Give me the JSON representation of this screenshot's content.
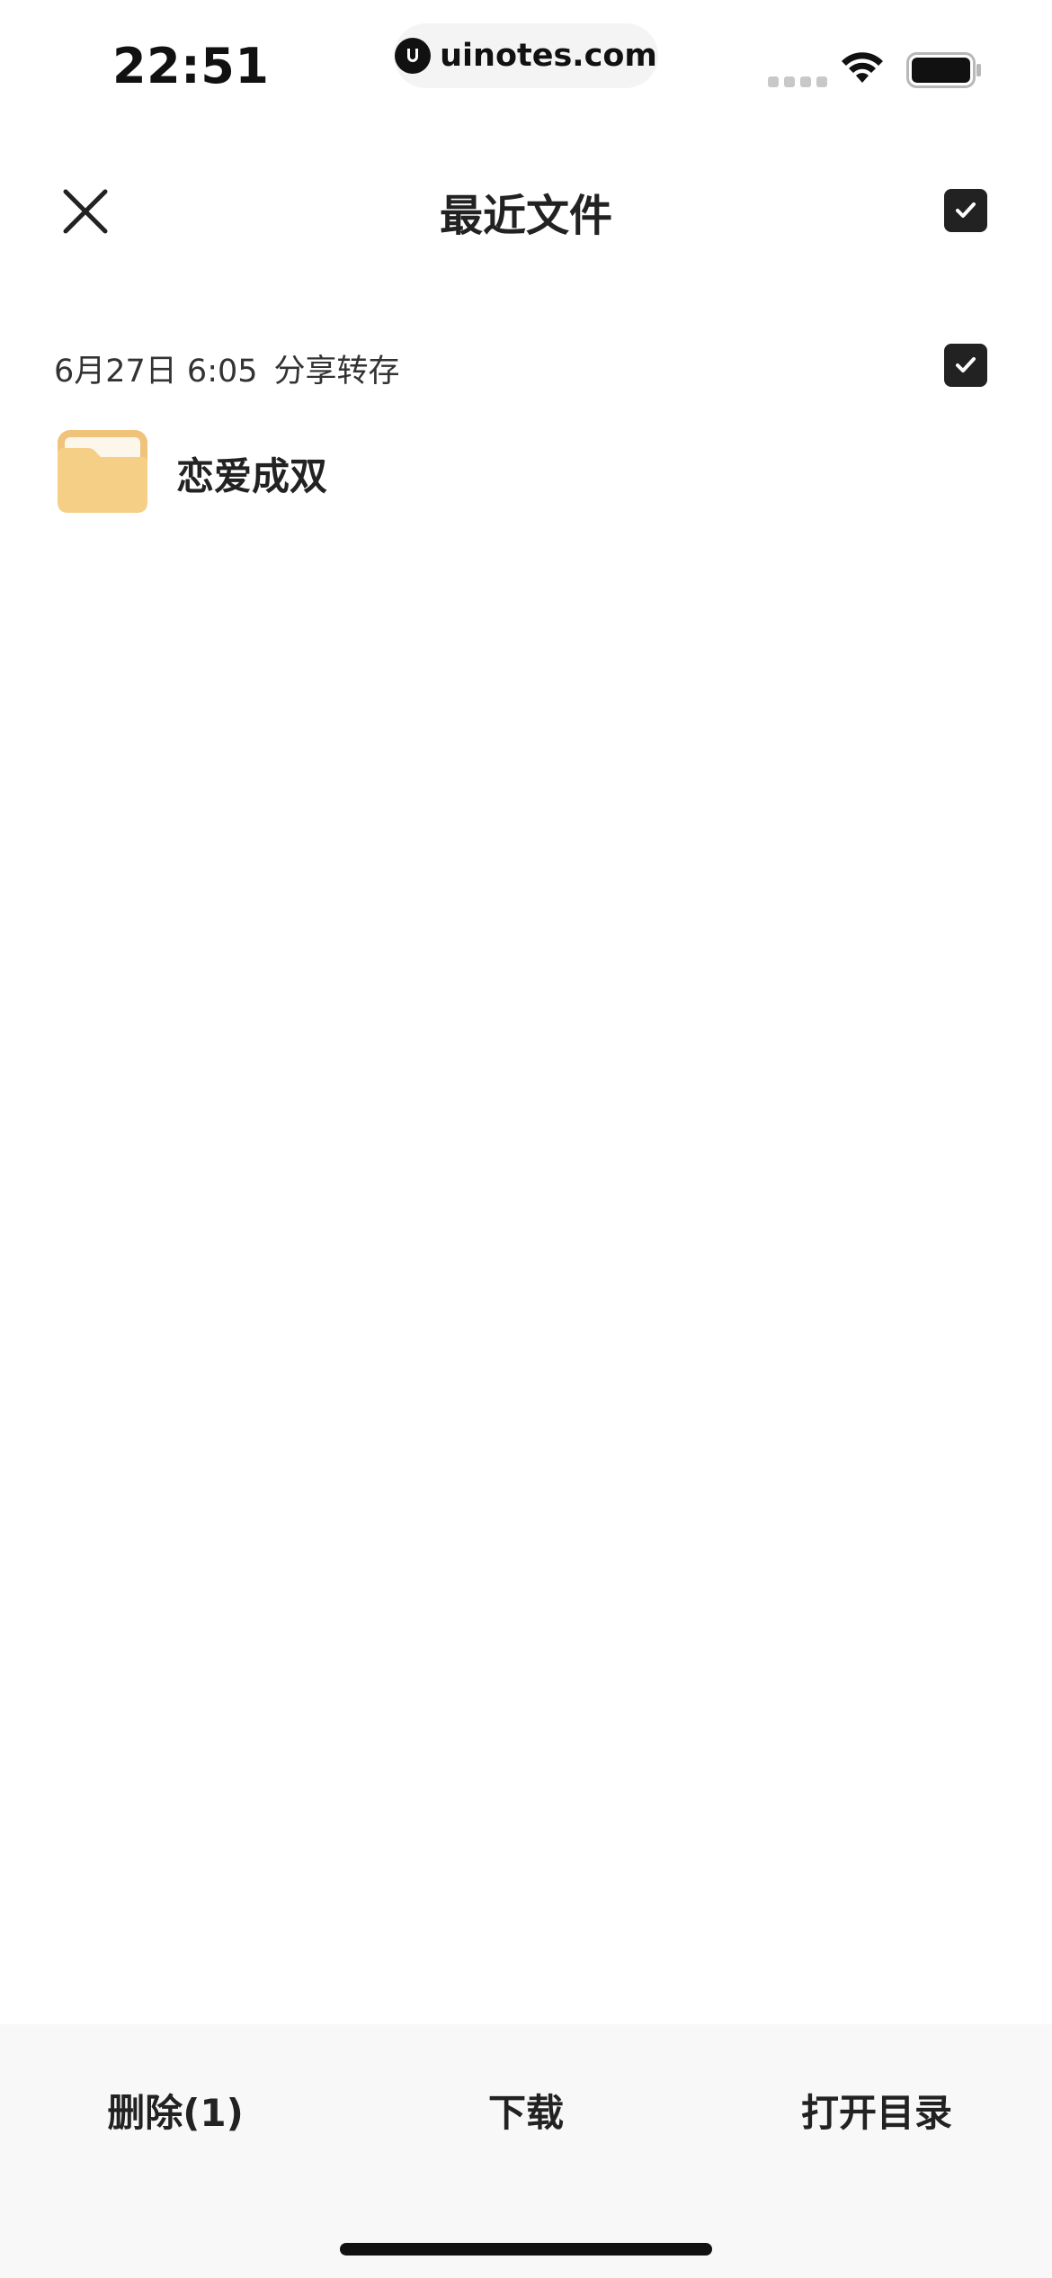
{
  "status_bar": {
    "time": "22:51",
    "url": "uinotes.com"
  },
  "header": {
    "title": "最近文件"
  },
  "group": {
    "date": "6月27日 6:05",
    "source": "分享转存",
    "selected": true
  },
  "files": [
    {
      "name": "恋爱成双",
      "type": "folder-icon",
      "selected": true
    }
  ],
  "toolbar": {
    "delete_label": "删除(1)",
    "download_label": "下载",
    "open_dir_label": "打开目录"
  },
  "colors": {
    "checkbox": "#222222",
    "folder": "#f5c97a",
    "toolbar_bg": "#f8f8f8"
  }
}
